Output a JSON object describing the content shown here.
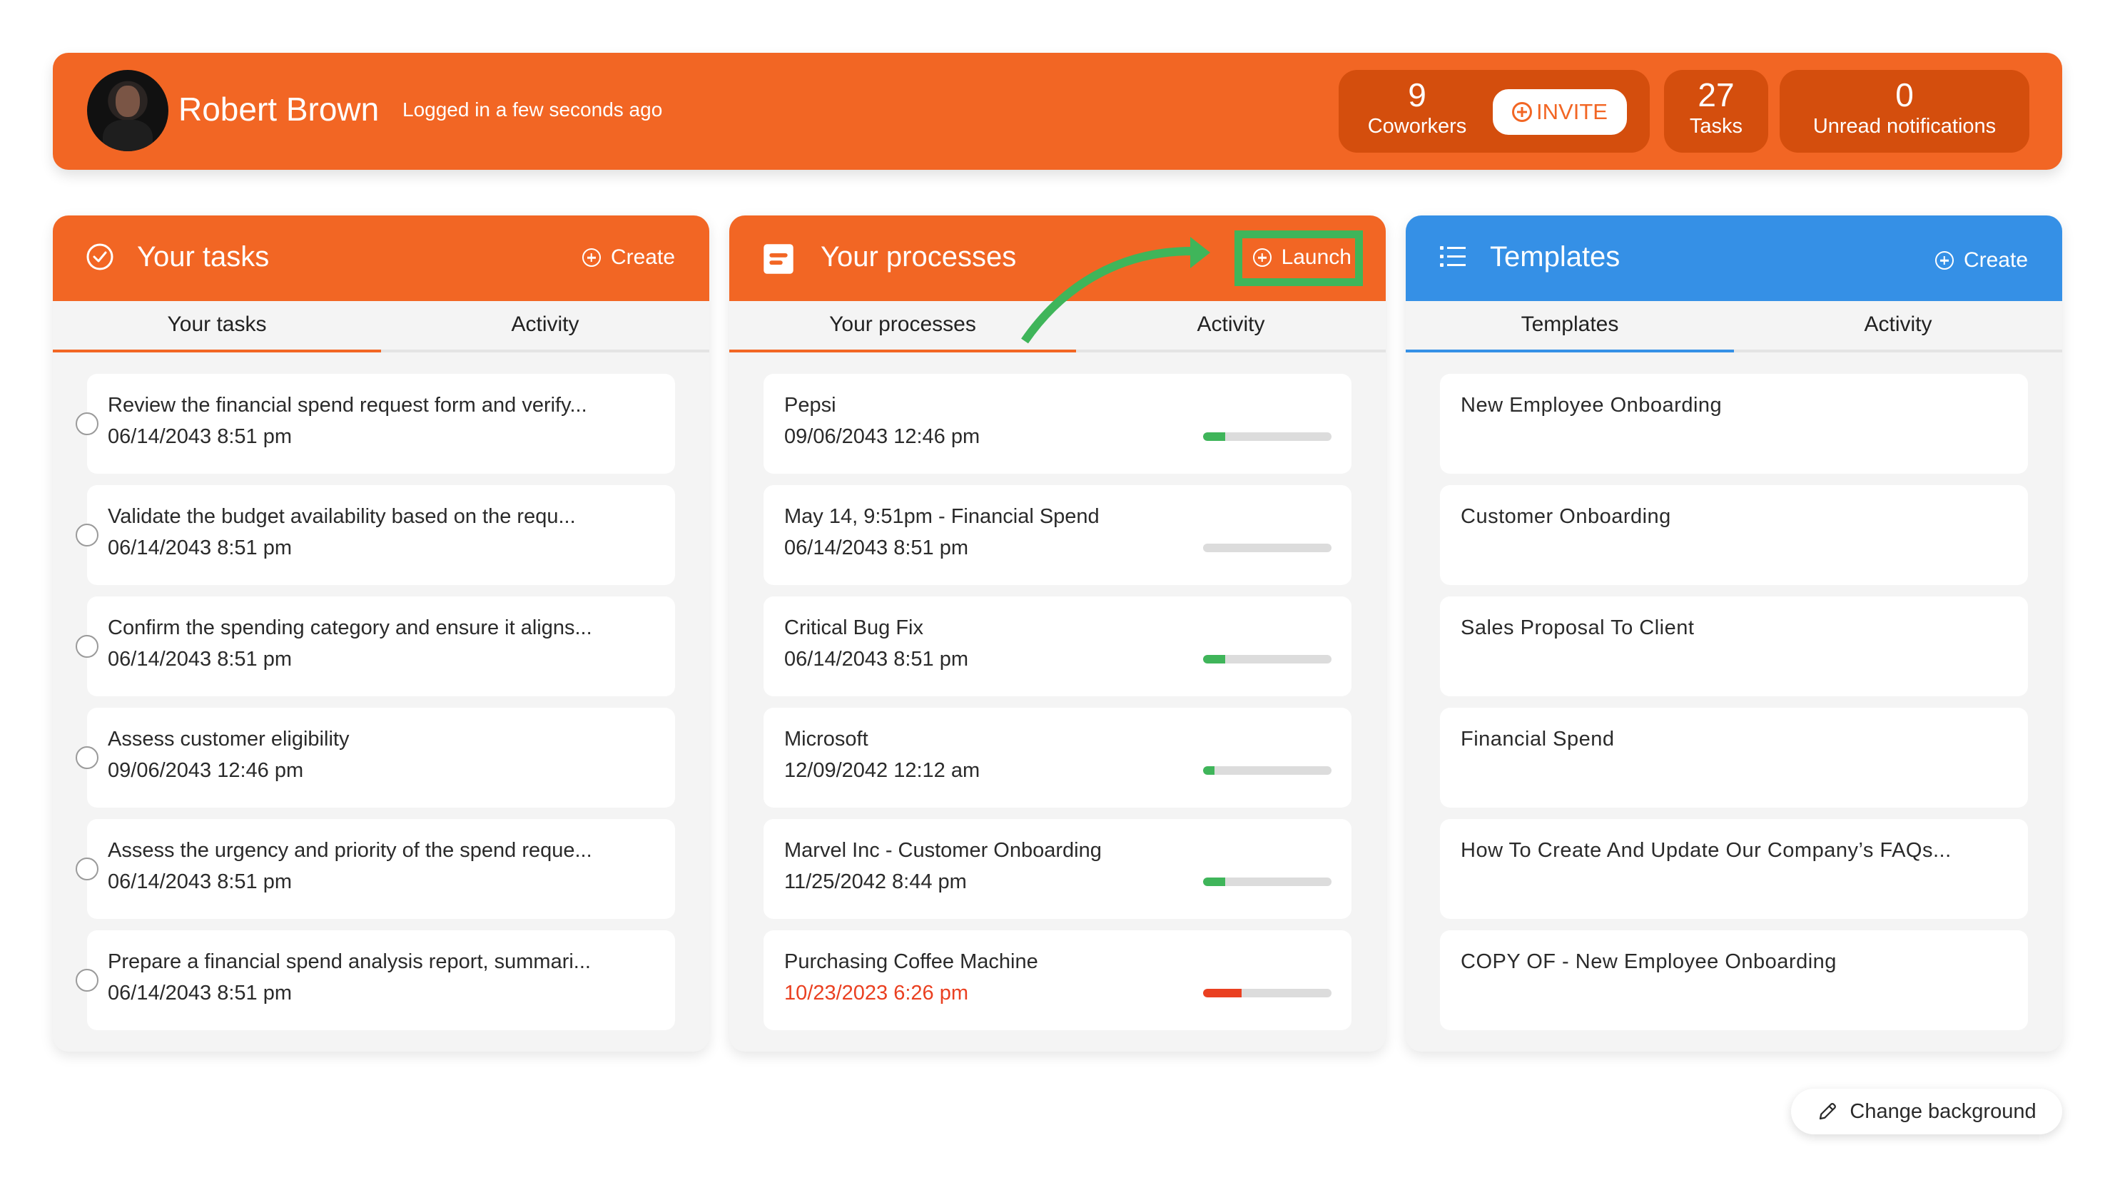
{
  "header": {
    "user_name": "Robert Brown",
    "login_status": "Logged in a few seconds ago",
    "stats": {
      "coworkers": {
        "count": "9",
        "label": "Coworkers"
      },
      "invite_label": "INVITE",
      "tasks": {
        "count": "27",
        "label": "Tasks"
      },
      "notifications": {
        "count": "0",
        "label": "Unread notifications"
      }
    }
  },
  "colors": {
    "brand_orange": "#f26624",
    "templates_blue": "#3590e6",
    "progress_green": "#3fb55a",
    "progress_red": "#ea4021",
    "annotation_green": "#3fb55a"
  },
  "panels": {
    "tasks": {
      "title": "Your tasks",
      "action_label": "Create",
      "tabs": [
        "Your tasks",
        "Activity"
      ],
      "active_tab": 0,
      "items": [
        {
          "title": "Review the financial spend request form and verify...",
          "date": "06/14/2043 8:51 pm"
        },
        {
          "title": "Validate the budget availability based on the requ...",
          "date": "06/14/2043 8:51 pm"
        },
        {
          "title": "Confirm the spending category and ensure it aligns...",
          "date": "06/14/2043 8:51 pm"
        },
        {
          "title": "Assess customer eligibility",
          "date": "09/06/2043 12:46 pm"
        },
        {
          "title": "Assess the urgency and priority of the spend reque...",
          "date": "06/14/2043 8:51 pm"
        },
        {
          "title": "Prepare a financial spend analysis report, summari...",
          "date": "06/14/2043 8:51 pm"
        }
      ]
    },
    "processes": {
      "title": "Your processes",
      "action_label": "Launch",
      "tabs": [
        "Your processes",
        "Activity"
      ],
      "active_tab": 0,
      "items": [
        {
          "title": "Pepsi",
          "date": "09/06/2043 12:46 pm",
          "progress": 0.17,
          "status": "ok"
        },
        {
          "title": "May 14, 9:51pm - Financial Spend",
          "date": "06/14/2043 8:51 pm",
          "progress": 0.0,
          "status": "ok"
        },
        {
          "title": "Critical Bug Fix",
          "date": "06/14/2043 8:51 pm",
          "progress": 0.17,
          "status": "ok"
        },
        {
          "title": "Microsoft",
          "date": "12/09/2042 12:12 am",
          "progress": 0.09,
          "status": "ok"
        },
        {
          "title": "Marvel Inc - Customer Onboarding",
          "date": "11/25/2042 8:44 pm",
          "progress": 0.17,
          "status": "ok"
        },
        {
          "title": "Purchasing Coffee Machine",
          "date": "10/23/2023 6:26 pm",
          "progress": 0.3,
          "status": "overdue"
        }
      ]
    },
    "templates": {
      "title": "Templates",
      "action_label": "Create",
      "tabs": [
        "Templates",
        "Activity"
      ],
      "active_tab": 0,
      "items": [
        {
          "title": "New Employee Onboarding"
        },
        {
          "title": "Customer Onboarding"
        },
        {
          "title": "Sales Proposal To Client"
        },
        {
          "title": "Financial Spend"
        },
        {
          "title": "How To Create And Update Our Company’s FAQs..."
        },
        {
          "title": "COPY OF - New Employee Onboarding"
        }
      ]
    }
  },
  "footer": {
    "change_background_label": "Change background"
  }
}
